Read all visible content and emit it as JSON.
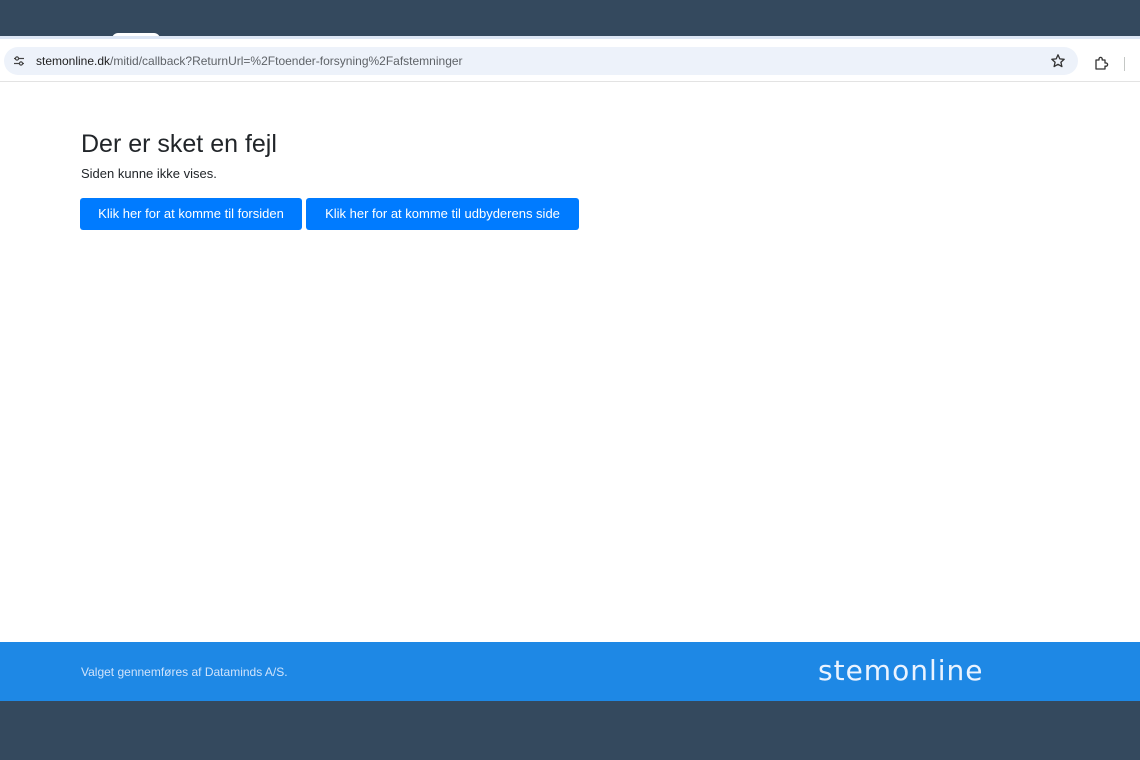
{
  "browser": {
    "url_host": "stemonline.dk",
    "url_path": "/mitid/callback?ReturnUrl=%2Ftoender-forsyning%2Fafstemninger"
  },
  "icons": {
    "site_info": "tune-icon",
    "bookmark": "star-icon",
    "extensions": "puzzle-icon"
  },
  "main": {
    "title": "Der er sket en fejl",
    "subtitle": "Siden kunne ikke vises.",
    "buttons": [
      {
        "label": "Klik her for at komme til forsiden"
      },
      {
        "label": "Klik her for at komme til udbyderens side"
      }
    ]
  },
  "footer": {
    "text": "Valget gennemføres af Dataminds A/S.",
    "brand": "stemonline"
  },
  "colors": {
    "primary_button": "#007bff",
    "footer_bg": "#1e88e5",
    "outer_bg": "#34495e"
  }
}
